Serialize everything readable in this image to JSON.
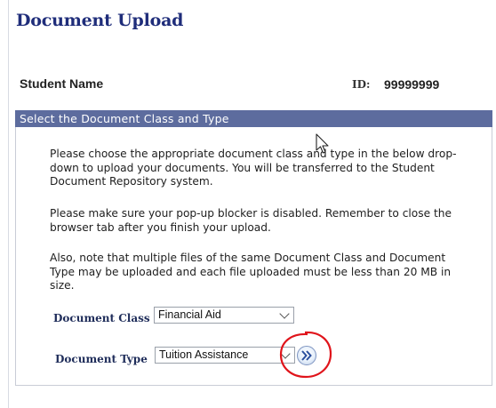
{
  "page": {
    "title": "Document Upload"
  },
  "student": {
    "name_label": "Student Name",
    "id_label": "ID:",
    "id_value": "99999999"
  },
  "section": {
    "header": "Select the Document Class and Type",
    "paragraph_1": "Please choose the appropriate document class and type in the below drop-down to upload your documents. You will be transferred to the Student Document Repository system.",
    "paragraph_2": "Please make sure your pop-up blocker is disabled. Remember to close the browser tab after you finish your upload.",
    "paragraph_3": "Also, note that multiple files of the same Document Class and Document Type may be uploaded and each file uploaded must be less than 20 MB in size."
  },
  "form": {
    "class_label": "Document Class",
    "class_value": "Financial Aid",
    "type_label": "Document Type",
    "type_value": "Tuition Assistance",
    "go_icon": "double-chevron-right-icon"
  },
  "colors": {
    "title": "#1f2d7a",
    "section_header_bg": "#5d6c9e",
    "highlight_circle": "#e0141b"
  }
}
